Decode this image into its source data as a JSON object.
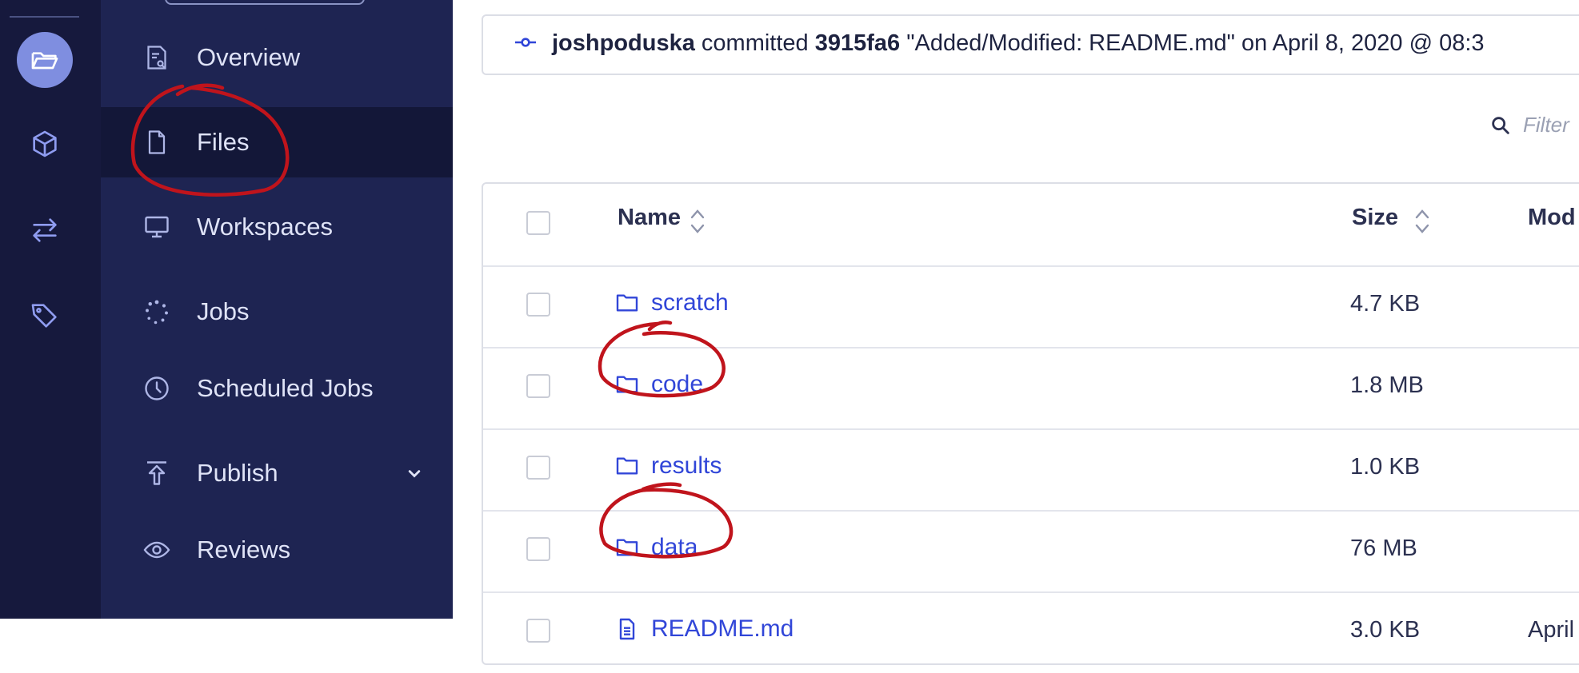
{
  "rail": {
    "items": [
      {
        "icon": "folder-open-icon",
        "active": true
      },
      {
        "icon": "cube-icon",
        "active": false
      },
      {
        "icon": "swap-arrows-icon",
        "active": false
      },
      {
        "icon": "tag-icon",
        "active": false
      }
    ]
  },
  "sidebar": {
    "items": [
      {
        "label": "Overview",
        "icon": "overview-icon"
      },
      {
        "label": "Files",
        "icon": "file-icon",
        "active": true
      },
      {
        "label": "Workspaces",
        "icon": "monitor-icon"
      },
      {
        "label": "Jobs",
        "icon": "spinner-icon"
      },
      {
        "label": "Scheduled Jobs",
        "icon": "clock-icon"
      },
      {
        "label": "Publish",
        "icon": "upload-icon",
        "has_dropdown": true
      },
      {
        "label": "Reviews",
        "icon": "eye-icon"
      }
    ]
  },
  "commit": {
    "user": "joshpoduska",
    "verb": "committed",
    "hash": "3915fa6",
    "message": "\"Added/Modified: README.md\"",
    "when": "on April 8, 2020 @ 08:3"
  },
  "filter": {
    "placeholder": "Filter"
  },
  "table": {
    "headers": {
      "name": "Name",
      "size": "Size",
      "modified": "Mod"
    },
    "rows": [
      {
        "name": "scratch",
        "type": "folder",
        "size": "4.7 KB",
        "modified": ""
      },
      {
        "name": "code",
        "type": "folder",
        "size": "1.8 MB",
        "modified": ""
      },
      {
        "name": "results",
        "type": "folder",
        "size": "1.0 KB",
        "modified": ""
      },
      {
        "name": "data",
        "type": "folder",
        "size": "76 MB",
        "modified": ""
      },
      {
        "name": "README.md",
        "type": "file",
        "size": "3.0 KB",
        "modified": "April"
      }
    ]
  },
  "colors": {
    "rail_bg": "#16193d",
    "sidebar_bg": "#1e2452",
    "active_item_bg": "#131738",
    "link": "#3146d8",
    "annotation_red": "#c0141c"
  }
}
